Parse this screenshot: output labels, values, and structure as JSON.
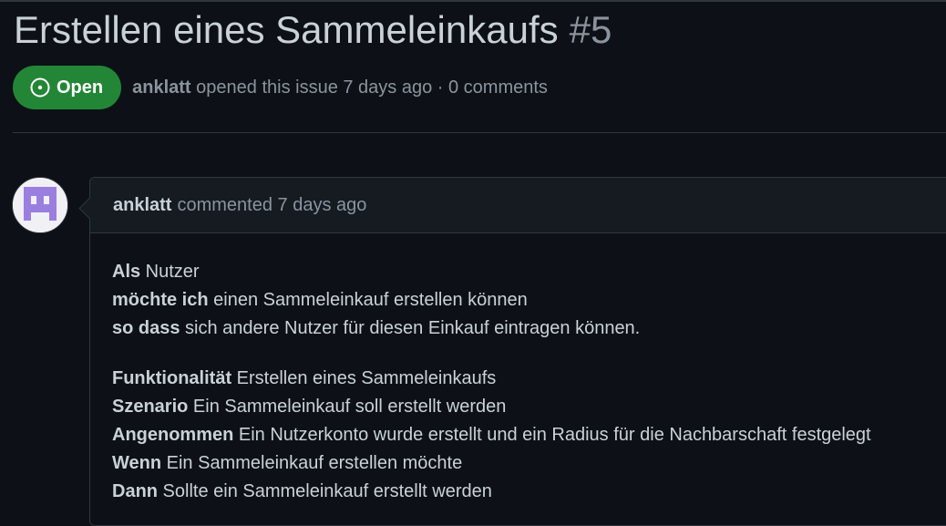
{
  "issue": {
    "title": "Erstellen eines Sammeleinkaufs",
    "number": "#5",
    "state_label": "Open",
    "state_color": "#238636",
    "author": "anklatt",
    "meta_suffix": "opened this issue 7 days ago · 0 comments"
  },
  "comment": {
    "author": "anklatt",
    "action": "commented 7 days ago",
    "avatar_icon": "identicon-avatar",
    "paragraphs": [
      {
        "lines": [
          {
            "bold": "Als",
            "text": " Nutzer"
          },
          {
            "bold": "möchte ich",
            "text": " einen Sammeleinkauf erstellen können"
          },
          {
            "bold": "so dass",
            "text": " sich andere Nutzer für diesen Einkauf eintragen können."
          }
        ]
      },
      {
        "lines": [
          {
            "bold": "Funktionalität",
            "text": " Erstellen eines Sammeleinkaufs"
          },
          {
            "bold": "Szenario",
            "text": " Ein Sammeleinkauf soll erstellt werden"
          },
          {
            "bold": "Angenommen",
            "text": " Ein Nutzerkonto wurde erstellt und ein Radius für die Nachbarschaft festgelegt"
          },
          {
            "bold": "Wenn",
            "text": " Ein Sammeleinkauf erstellen möchte"
          },
          {
            "bold": "Dann",
            "text": " Sollte ein Sammeleinkauf erstellt werden"
          }
        ]
      }
    ]
  },
  "colors": {
    "background": "#0d1117",
    "border": "#30363d",
    "header_bg": "#161b22",
    "muted_text": "#8b949e",
    "avatar_accent": "#9b7fe0"
  }
}
